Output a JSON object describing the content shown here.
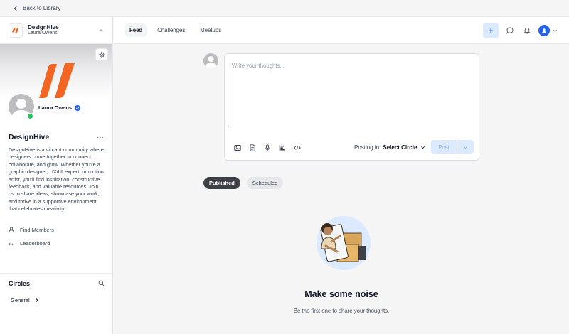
{
  "back": {
    "label": "Back to Library"
  },
  "community": {
    "name": "DesignHive",
    "owner": "Laura Owens",
    "brand_color": "#f26522"
  },
  "profile": {
    "name": "Laura Owens",
    "title": "DesignHive",
    "description": "DesignHive is a vibrant community where designers come together to connect, collaborate, and grow. Whether you're a graphic designer, UX/UI expert, or motion artist, you'll find inspiration, constructive feedback, and valuable resources. Join us to share ideas, showcase your work, and thrive in a supportive environment that celebrates creativity."
  },
  "sidebar": {
    "nav": [
      {
        "label": "Find Members",
        "icon": "person-icon"
      },
      {
        "label": "Leaderboard",
        "icon": "bar-chart-icon"
      }
    ],
    "circles": {
      "title": "Circles",
      "items": [
        {
          "label": "General"
        }
      ]
    }
  },
  "tabs": [
    {
      "label": "Feed",
      "active": true
    },
    {
      "label": "Challenges",
      "active": false
    },
    {
      "label": "Meetups",
      "active": false
    }
  ],
  "header": {
    "plus_label": "+"
  },
  "composer": {
    "placeholder": "Write your thoughts...",
    "posting_prefix": "Posting in:",
    "circle_select": "Select Circle",
    "post_label": "Post"
  },
  "filters": [
    {
      "label": "Published",
      "active": true
    },
    {
      "label": "Scheduled",
      "active": false
    }
  ],
  "empty": {
    "title": "Make some noise",
    "subtitle": "Be the first one to share your thoughts."
  },
  "colors": {
    "accent": "#2563eb",
    "online": "#22c55e"
  }
}
